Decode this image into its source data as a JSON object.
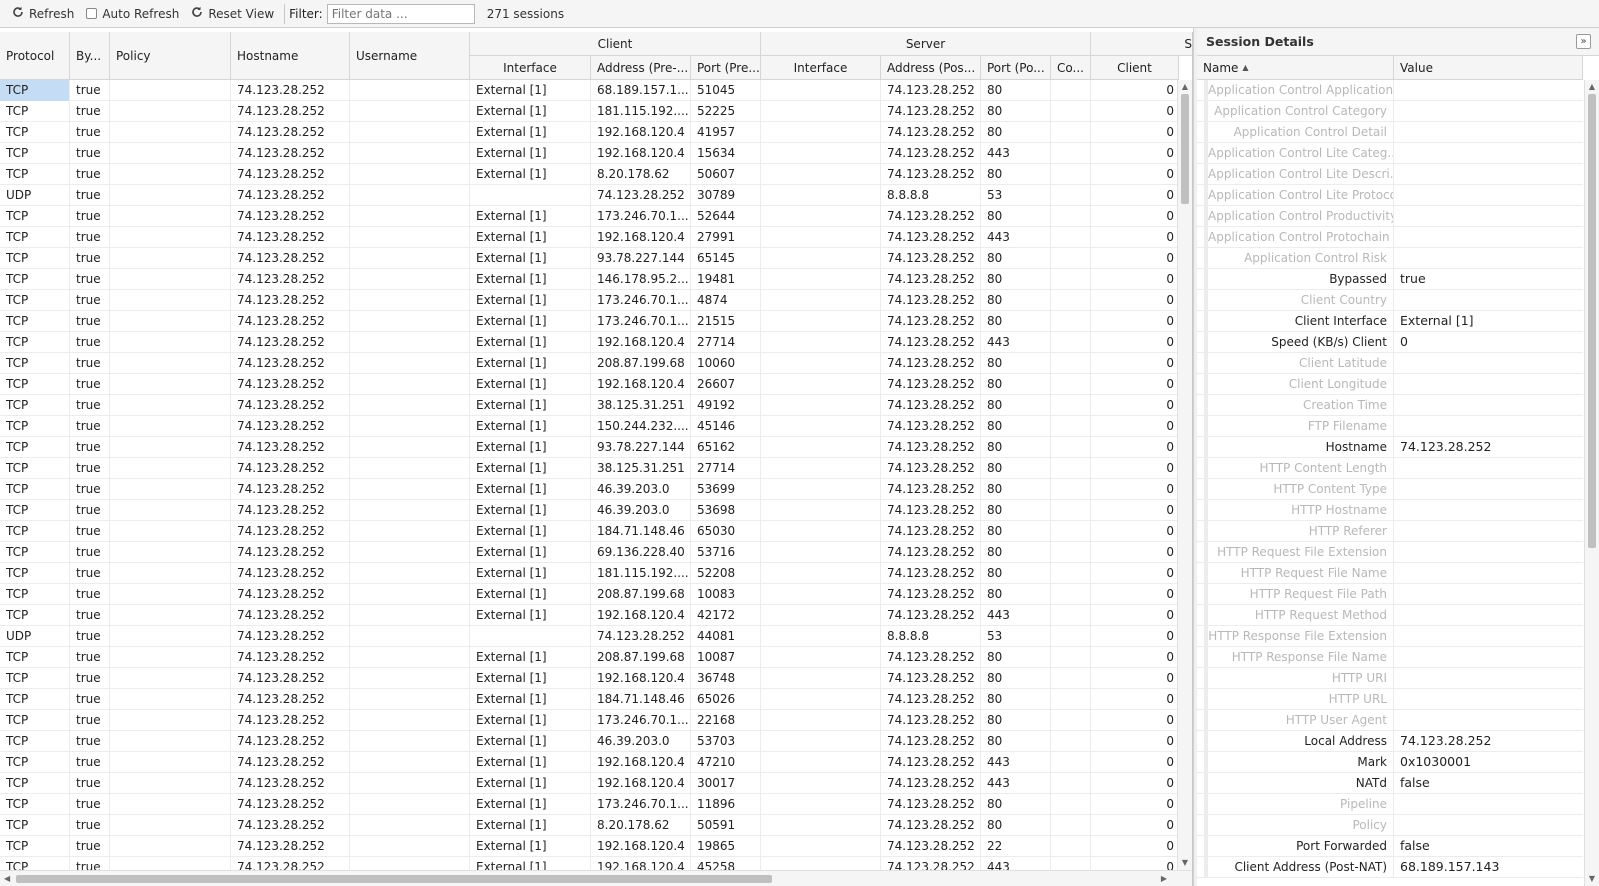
{
  "toolbar": {
    "refresh_label": "Refresh",
    "auto_refresh_label": "Auto Refresh",
    "reset_view_label": "Reset View",
    "filter_label": "Filter:",
    "filter_placeholder": "Filter data ...",
    "session_count": "271 sessions"
  },
  "grid": {
    "groups": {
      "client": "Client",
      "server": "Server",
      "more": "S"
    },
    "headers": {
      "protocol": "Protocol",
      "bypassed": "By...",
      "policy": "Policy",
      "hostname": "Hostname",
      "username": "Username",
      "client_interface": "Interface",
      "client_address": "Address (Pre-...",
      "client_port": "Port (Pre...",
      "server_interface": "Interface",
      "server_address": "Address (Pos...",
      "server_port": "Port (Po...",
      "country": "Co...",
      "speed_client": "Client"
    },
    "rows": [
      [
        "TCP",
        "true",
        "",
        "74.123.28.252",
        "",
        "External [1]",
        "68.189.157.1...",
        "51045",
        "",
        "74.123.28.252",
        "80",
        "",
        "0"
      ],
      [
        "TCP",
        "true",
        "",
        "74.123.28.252",
        "",
        "External [1]",
        "181.115.192....",
        "52225",
        "",
        "74.123.28.252",
        "80",
        "",
        "0"
      ],
      [
        "TCP",
        "true",
        "",
        "74.123.28.252",
        "",
        "External [1]",
        "192.168.120.4",
        "41957",
        "",
        "74.123.28.252",
        "80",
        "",
        "0"
      ],
      [
        "TCP",
        "true",
        "",
        "74.123.28.252",
        "",
        "External [1]",
        "192.168.120.4",
        "15634",
        "",
        "74.123.28.252",
        "443",
        "",
        "0"
      ],
      [
        "TCP",
        "true",
        "",
        "74.123.28.252",
        "",
        "External [1]",
        "8.20.178.62",
        "50607",
        "",
        "74.123.28.252",
        "80",
        "",
        "0"
      ],
      [
        "UDP",
        "true",
        "",
        "74.123.28.252",
        "",
        "",
        "74.123.28.252",
        "30789",
        "",
        "8.8.8.8",
        "53",
        "",
        "0"
      ],
      [
        "TCP",
        "true",
        "",
        "74.123.28.252",
        "",
        "External [1]",
        "173.246.70.1...",
        "52644",
        "",
        "74.123.28.252",
        "80",
        "",
        "0"
      ],
      [
        "TCP",
        "true",
        "",
        "74.123.28.252",
        "",
        "External [1]",
        "192.168.120.4",
        "27991",
        "",
        "74.123.28.252",
        "443",
        "",
        "0"
      ],
      [
        "TCP",
        "true",
        "",
        "74.123.28.252",
        "",
        "External [1]",
        "93.78.227.144",
        "65145",
        "",
        "74.123.28.252",
        "80",
        "",
        "0"
      ],
      [
        "TCP",
        "true",
        "",
        "74.123.28.252",
        "",
        "External [1]",
        "146.178.95.2...",
        "19481",
        "",
        "74.123.28.252",
        "80",
        "",
        "0"
      ],
      [
        "TCP",
        "true",
        "",
        "74.123.28.252",
        "",
        "External [1]",
        "173.246.70.1...",
        "4874",
        "",
        "74.123.28.252",
        "80",
        "",
        "0"
      ],
      [
        "TCP",
        "true",
        "",
        "74.123.28.252",
        "",
        "External [1]",
        "173.246.70.1...",
        "21515",
        "",
        "74.123.28.252",
        "80",
        "",
        "0"
      ],
      [
        "TCP",
        "true",
        "",
        "74.123.28.252",
        "",
        "External [1]",
        "192.168.120.4",
        "27714",
        "",
        "74.123.28.252",
        "443",
        "",
        "0"
      ],
      [
        "TCP",
        "true",
        "",
        "74.123.28.252",
        "",
        "External [1]",
        "208.87.199.68",
        "10060",
        "",
        "74.123.28.252",
        "80",
        "",
        "0"
      ],
      [
        "TCP",
        "true",
        "",
        "74.123.28.252",
        "",
        "External [1]",
        "192.168.120.4",
        "26607",
        "",
        "74.123.28.252",
        "80",
        "",
        "0"
      ],
      [
        "TCP",
        "true",
        "",
        "74.123.28.252",
        "",
        "External [1]",
        "38.125.31.251",
        "49192",
        "",
        "74.123.28.252",
        "80",
        "",
        "0"
      ],
      [
        "TCP",
        "true",
        "",
        "74.123.28.252",
        "",
        "External [1]",
        "150.244.232....",
        "45146",
        "",
        "74.123.28.252",
        "80",
        "",
        "0"
      ],
      [
        "TCP",
        "true",
        "",
        "74.123.28.252",
        "",
        "External [1]",
        "93.78.227.144",
        "65162",
        "",
        "74.123.28.252",
        "80",
        "",
        "0"
      ],
      [
        "TCP",
        "true",
        "",
        "74.123.28.252",
        "",
        "External [1]",
        "38.125.31.251",
        "27714",
        "",
        "74.123.28.252",
        "80",
        "",
        "0"
      ],
      [
        "TCP",
        "true",
        "",
        "74.123.28.252",
        "",
        "External [1]",
        "46.39.203.0",
        "53699",
        "",
        "74.123.28.252",
        "80",
        "",
        "0"
      ],
      [
        "TCP",
        "true",
        "",
        "74.123.28.252",
        "",
        "External [1]",
        "46.39.203.0",
        "53698",
        "",
        "74.123.28.252",
        "80",
        "",
        "0"
      ],
      [
        "TCP",
        "true",
        "",
        "74.123.28.252",
        "",
        "External [1]",
        "184.71.148.46",
        "65030",
        "",
        "74.123.28.252",
        "80",
        "",
        "0"
      ],
      [
        "TCP",
        "true",
        "",
        "74.123.28.252",
        "",
        "External [1]",
        "69.136.228.40",
        "53716",
        "",
        "74.123.28.252",
        "80",
        "",
        "0"
      ],
      [
        "TCP",
        "true",
        "",
        "74.123.28.252",
        "",
        "External [1]",
        "181.115.192....",
        "52208",
        "",
        "74.123.28.252",
        "80",
        "",
        "0"
      ],
      [
        "TCP",
        "true",
        "",
        "74.123.28.252",
        "",
        "External [1]",
        "208.87.199.68",
        "10083",
        "",
        "74.123.28.252",
        "80",
        "",
        "0"
      ],
      [
        "TCP",
        "true",
        "",
        "74.123.28.252",
        "",
        "External [1]",
        "192.168.120.4",
        "42172",
        "",
        "74.123.28.252",
        "443",
        "",
        "0"
      ],
      [
        "UDP",
        "true",
        "",
        "74.123.28.252",
        "",
        "",
        "74.123.28.252",
        "44081",
        "",
        "8.8.8.8",
        "53",
        "",
        "0"
      ],
      [
        "TCP",
        "true",
        "",
        "74.123.28.252",
        "",
        "External [1]",
        "208.87.199.68",
        "10087",
        "",
        "74.123.28.252",
        "80",
        "",
        "0"
      ],
      [
        "TCP",
        "true",
        "",
        "74.123.28.252",
        "",
        "External [1]",
        "192.168.120.4",
        "36748",
        "",
        "74.123.28.252",
        "80",
        "",
        "0"
      ],
      [
        "TCP",
        "true",
        "",
        "74.123.28.252",
        "",
        "External [1]",
        "184.71.148.46",
        "65026",
        "",
        "74.123.28.252",
        "80",
        "",
        "0"
      ],
      [
        "TCP",
        "true",
        "",
        "74.123.28.252",
        "",
        "External [1]",
        "173.246.70.1...",
        "22168",
        "",
        "74.123.28.252",
        "80",
        "",
        "0"
      ],
      [
        "TCP",
        "true",
        "",
        "74.123.28.252",
        "",
        "External [1]",
        "46.39.203.0",
        "53703",
        "",
        "74.123.28.252",
        "80",
        "",
        "0"
      ],
      [
        "TCP",
        "true",
        "",
        "74.123.28.252",
        "",
        "External [1]",
        "192.168.120.4",
        "47210",
        "",
        "74.123.28.252",
        "443",
        "",
        "0"
      ],
      [
        "TCP",
        "true",
        "",
        "74.123.28.252",
        "",
        "External [1]",
        "192.168.120.4",
        "30017",
        "",
        "74.123.28.252",
        "443",
        "",
        "0"
      ],
      [
        "TCP",
        "true",
        "",
        "74.123.28.252",
        "",
        "External [1]",
        "173.246.70.1...",
        "11896",
        "",
        "74.123.28.252",
        "80",
        "",
        "0"
      ],
      [
        "TCP",
        "true",
        "",
        "74.123.28.252",
        "",
        "External [1]",
        "8.20.178.62",
        "50591",
        "",
        "74.123.28.252",
        "80",
        "",
        "0"
      ],
      [
        "TCP",
        "true",
        "",
        "74.123.28.252",
        "",
        "External [1]",
        "192.168.120.4",
        "19865",
        "",
        "74.123.28.252",
        "22",
        "",
        "0"
      ],
      [
        "TCP",
        "true",
        "",
        "74.123.28.252",
        "",
        "External [1]",
        "192.168.120.4",
        "45258",
        "",
        "74.123.28.252",
        "443",
        "",
        "0"
      ]
    ]
  },
  "details": {
    "title": "Session Details",
    "col_name": "Name",
    "col_value": "Value",
    "rows": [
      {
        "name": "Application Control Application",
        "value": "",
        "dim": true
      },
      {
        "name": "Application Control Category",
        "value": "",
        "dim": true
      },
      {
        "name": "Application Control Detail",
        "value": "",
        "dim": true
      },
      {
        "name": "Application Control Lite Categ...",
        "value": "",
        "dim": true
      },
      {
        "name": "Application Control Lite Descri...",
        "value": "",
        "dim": true
      },
      {
        "name": "Application Control Lite Protocol",
        "value": "",
        "dim": true
      },
      {
        "name": "Application Control Productivity",
        "value": "",
        "dim": true
      },
      {
        "name": "Application Control Protochain",
        "value": "",
        "dim": true
      },
      {
        "name": "Application Control Risk",
        "value": "",
        "dim": true
      },
      {
        "name": "Bypassed",
        "value": "true",
        "dim": false
      },
      {
        "name": "Client Country",
        "value": "",
        "dim": true
      },
      {
        "name": "Client Interface",
        "value": "External [1]",
        "dim": false
      },
      {
        "name": "Speed (KB/s) Client",
        "value": "0",
        "dim": false
      },
      {
        "name": "Client Latitude",
        "value": "",
        "dim": true
      },
      {
        "name": "Client Longitude",
        "value": "",
        "dim": true
      },
      {
        "name": "Creation Time",
        "value": "",
        "dim": true
      },
      {
        "name": "FTP Filename",
        "value": "",
        "dim": true
      },
      {
        "name": "Hostname",
        "value": "74.123.28.252",
        "dim": false
      },
      {
        "name": "HTTP Content Length",
        "value": "",
        "dim": true
      },
      {
        "name": "HTTP Content Type",
        "value": "",
        "dim": true
      },
      {
        "name": "HTTP Hostname",
        "value": "",
        "dim": true
      },
      {
        "name": "HTTP Referer",
        "value": "",
        "dim": true
      },
      {
        "name": "HTTP Request File Extension",
        "value": "",
        "dim": true
      },
      {
        "name": "HTTP Request File Name",
        "value": "",
        "dim": true
      },
      {
        "name": "HTTP Request File Path",
        "value": "",
        "dim": true
      },
      {
        "name": "HTTP Request Method",
        "value": "",
        "dim": true
      },
      {
        "name": "HTTP Response File Extension",
        "value": "",
        "dim": true
      },
      {
        "name": "HTTP Response File Name",
        "value": "",
        "dim": true
      },
      {
        "name": "HTTP URI",
        "value": "",
        "dim": true
      },
      {
        "name": "HTTP URL",
        "value": "",
        "dim": true
      },
      {
        "name": "HTTP User Agent",
        "value": "",
        "dim": true
      },
      {
        "name": "Local Address",
        "value": "74.123.28.252",
        "dim": false
      },
      {
        "name": "Mark",
        "value": "0x1030001",
        "dim": false
      },
      {
        "name": "NATd",
        "value": "false",
        "dim": false
      },
      {
        "name": "Pipeline",
        "value": "",
        "dim": true
      },
      {
        "name": "Policy",
        "value": "",
        "dim": true
      },
      {
        "name": "Port Forwarded",
        "value": "false",
        "dim": false
      },
      {
        "name": "Client Address (Post-NAT)",
        "value": "68.189.157.143",
        "dim": false
      }
    ]
  }
}
